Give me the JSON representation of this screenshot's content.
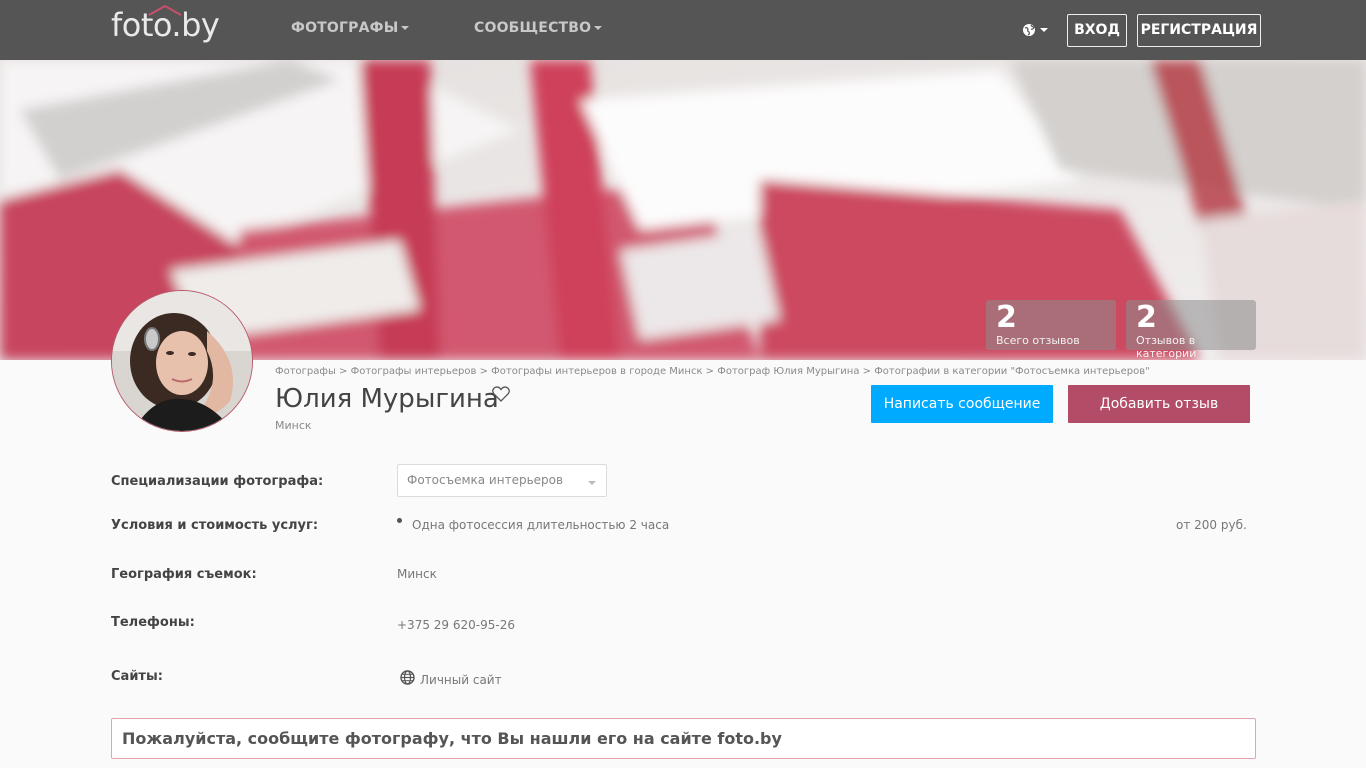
{
  "header": {
    "logo_text": "foto.by",
    "nav": [
      {
        "label": "ФОТОГРАФЫ"
      },
      {
        "label": "СООБЩЕСТВО"
      }
    ],
    "login_label": "ВХОД",
    "register_label": "РЕГИСТРАЦИЯ",
    "language_icon": "globe-icon"
  },
  "stats": [
    {
      "value": "2",
      "label": "Всего отзывов"
    },
    {
      "value": "2",
      "label": "Отзывов в категории"
    }
  ],
  "breadcrumb": [
    "Фотографы",
    "Фотографы интерьеров",
    "Фотографы интерьеров в городе Минск",
    "Фотограф Юлия Мурыгина",
    "Фотографии в категории \"Фотосъемка интерьеров\""
  ],
  "profile": {
    "name": "Юлия Мурыгина",
    "city": "Минск",
    "message_button": "Написать сообщение",
    "review_button": "Добавить отзыв"
  },
  "details": {
    "specializations_label": "Специализации фотографа:",
    "specialization_selected": "Фотосъемка интерьеров",
    "services_label": "Условия и стоимость услуг:",
    "service_name": "Одна фотосессия длительностью 2 часа",
    "service_price": "от 200 руб.",
    "geography_label": "География съемок:",
    "geography_value": "Минск",
    "phones_label": "Телефоны:",
    "phone_value": "+375 29 620-95-26",
    "sites_label": "Сайты:",
    "site_value": "Личный сайт"
  },
  "notice": "Пожалуйста, сообщите фотографу, что Вы нашли его на сайте foto.by",
  "colors": {
    "navbar": "#555555",
    "primary_button": "#00aaff",
    "review_button": "#b24c67",
    "notice_border": "#e6a2ae"
  }
}
